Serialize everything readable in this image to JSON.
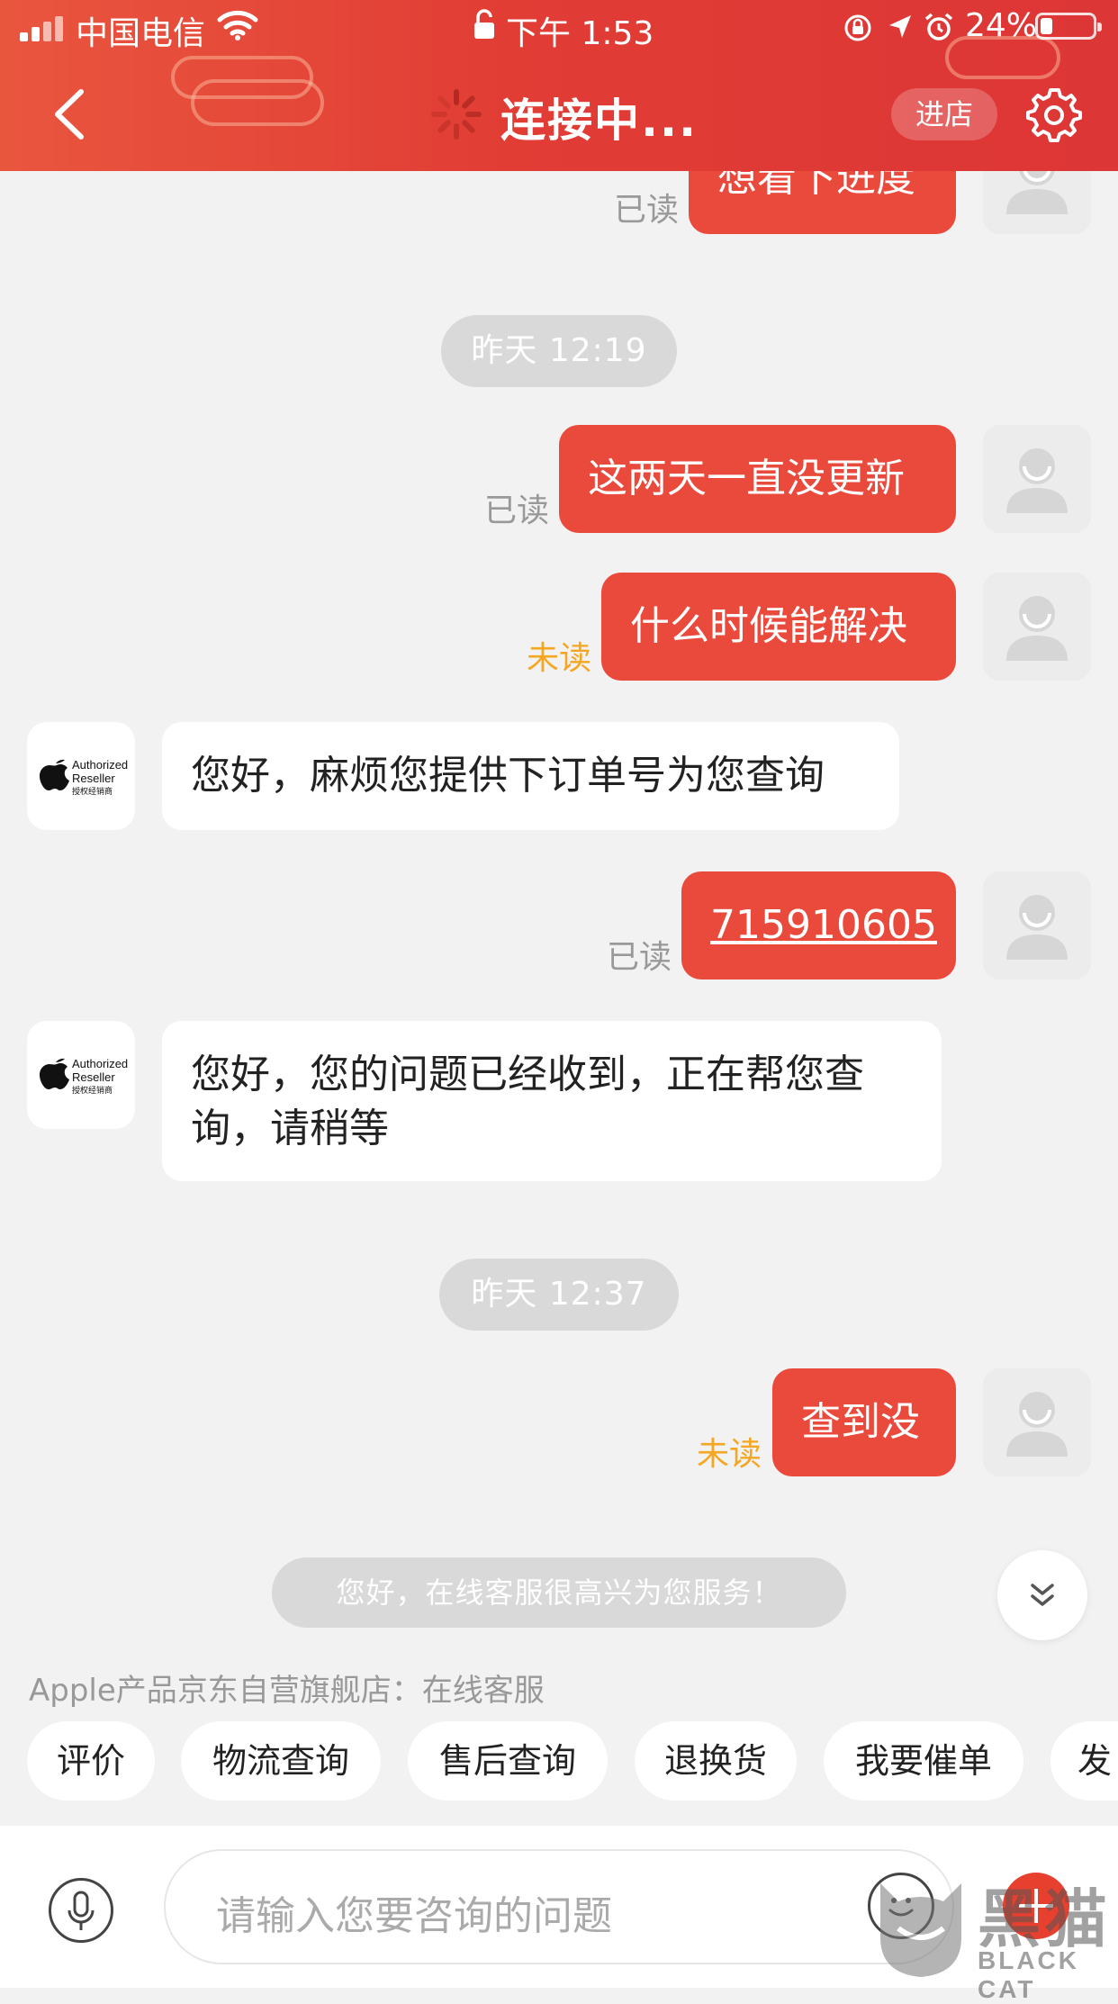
{
  "status_bar": {
    "carrier": "中国电信",
    "time": "下午 1:53",
    "battery": "24%",
    "battery_level": 0.24
  },
  "header": {
    "title": "连接中...",
    "enter_store_label": "进店",
    "colors": {
      "primary": "#e13d35",
      "bubble": "#ea4a3c"
    }
  },
  "messages": {
    "m0": {
      "text": "想看下进度",
      "status": "已读"
    },
    "t1": "昨天 12:19",
    "m1": {
      "text": "这两天一直没更新",
      "status": "已读"
    },
    "m2": {
      "text": "什么时候能解决",
      "status": "未读"
    },
    "m3": {
      "text": "您好，麻烦您提供下订单号为您查询"
    },
    "m4": {
      "text": "715910605",
      "status": "已读"
    },
    "m5": {
      "text": "您好，您的问题已经收到，正在帮您查询，请稍等"
    },
    "t2": "昨天 12:37",
    "m6": {
      "text": "查到没",
      "status": "未读"
    }
  },
  "shop_avatar": {
    "line1": "Authorized",
    "line2": "Reseller",
    "line3": "授权经销商"
  },
  "welcome_text": "您好，在线客服很高兴为您服务！",
  "store_label": "Apple产品京东自营旗舰店：在线客服",
  "quick_actions": [
    "评价",
    "物流查询",
    "售后查询",
    "退换货",
    "我要催单",
    "发"
  ],
  "input": {
    "placeholder": "请输入您要咨询的问题"
  },
  "watermark": {
    "cn": "黑猫",
    "en": "BLACK CAT"
  }
}
